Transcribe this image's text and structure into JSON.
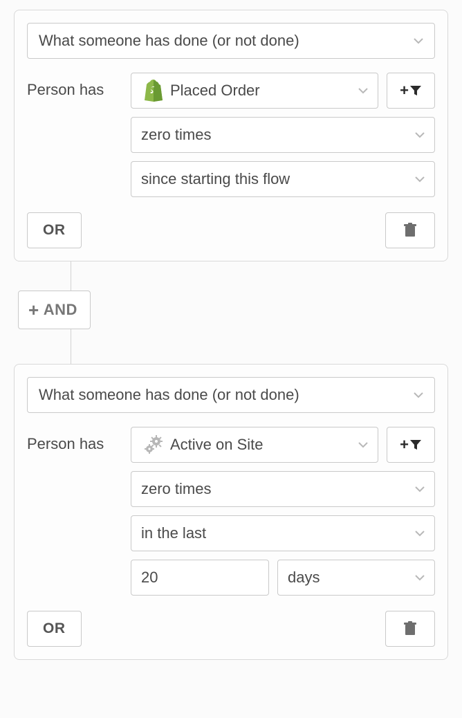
{
  "blocks": [
    {
      "condition_type": "What someone has done (or not done)",
      "subject_label": "Person has",
      "metric": {
        "icon": "shopify",
        "label": "Placed Order"
      },
      "count_operator": "zero times",
      "timeframe": {
        "mode": "since starting this flow"
      },
      "or_label": "OR"
    },
    {
      "condition_type": "What someone has done (or not done)",
      "subject_label": "Person has",
      "metric": {
        "icon": "gears",
        "label": "Active on Site"
      },
      "count_operator": "zero times",
      "timeframe": {
        "mode": "in the last",
        "value": "20",
        "unit": "days"
      },
      "or_label": "OR"
    }
  ],
  "and_label": "AND"
}
